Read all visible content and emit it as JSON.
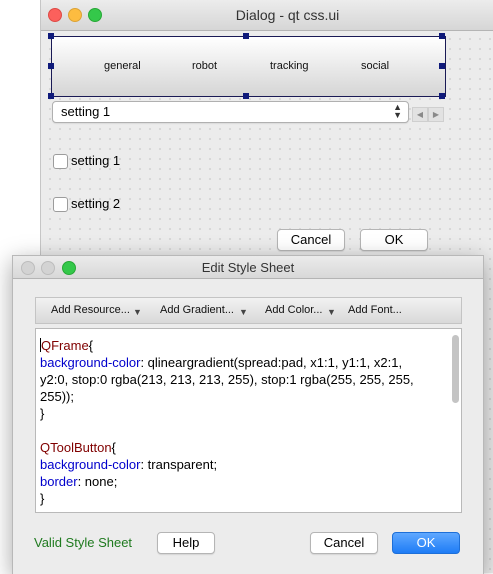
{
  "designer_window": {
    "title": "Dialog - qt css.ui",
    "frame_buttons": [
      "general",
      "robot",
      "tracking",
      "social"
    ],
    "combo": {
      "value": "setting 1"
    },
    "checkboxes": [
      {
        "label": "setting 1",
        "checked": false
      },
      {
        "label": "setting 2",
        "checked": false
      }
    ],
    "cancel_label": "Cancel",
    "ok_label": "OK"
  },
  "style_window": {
    "title": "Edit Style Sheet",
    "toolbar": {
      "add_resource": "Add Resource...",
      "add_gradient": "Add Gradient...",
      "add_color": "Add Color...",
      "add_font": "Add Font..."
    },
    "code": {
      "line1_selector": "QFrame",
      "line1_brace": "{",
      "line2_prop": "background-color",
      "line2_value": ": qlineargradient(spread:pad, x1:1, y1:1, x2:1,",
      "line3": "y2:0, stop:0 rgba(213, 213, 213, 255), stop:1 rgba(255, 255, 255,",
      "line4": "255));",
      "line5": "}",
      "line7_selector": "QToolButton",
      "line7_brace": "{",
      "line8_prop": "background-color",
      "line8_value": ": transparent;",
      "line9_prop": "border",
      "line9_value": ": none;",
      "line10": "}"
    },
    "status": "Valid Style Sheet",
    "help_label": "Help",
    "cancel_label": "Cancel",
    "ok_label": "OK"
  },
  "colors": {
    "selector": "#800000",
    "property": "#0000cc",
    "valid_status": "#1f7a1f",
    "primary_button": "#1e7cf6"
  }
}
